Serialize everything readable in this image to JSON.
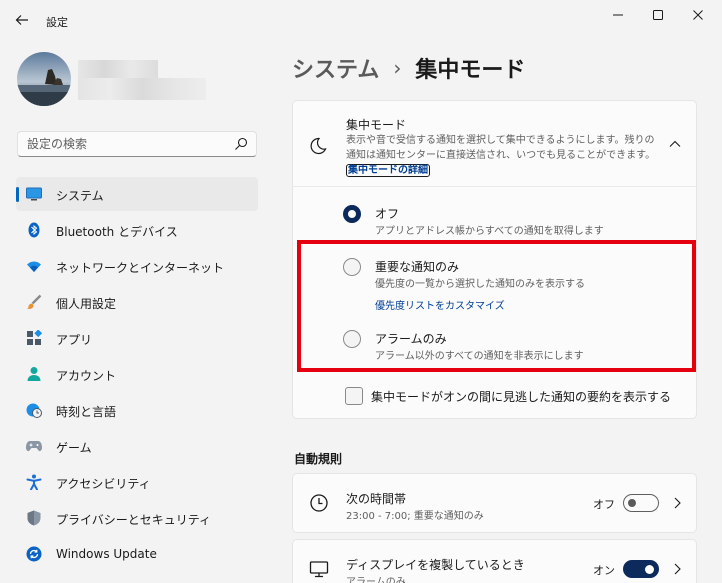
{
  "window": {
    "title": "設定"
  },
  "sidebar": {
    "search_placeholder": "設定の検索",
    "items": [
      {
        "label": "システム",
        "icon": "monitor-icon",
        "selected": true
      },
      {
        "label": "Bluetooth とデバイス",
        "icon": "bluetooth-icon"
      },
      {
        "label": "ネットワークとインターネット",
        "icon": "wifi-icon"
      },
      {
        "label": "個人用設定",
        "icon": "brush-icon"
      },
      {
        "label": "アプリ",
        "icon": "apps-icon"
      },
      {
        "label": "アカウント",
        "icon": "person-icon"
      },
      {
        "label": "時刻と言語",
        "icon": "globe-clock-icon"
      },
      {
        "label": "ゲーム",
        "icon": "gamepad-icon"
      },
      {
        "label": "アクセシビリティ",
        "icon": "accessibility-icon"
      },
      {
        "label": "プライバシーとセキュリティ",
        "icon": "shield-icon"
      },
      {
        "label": "Windows Update",
        "icon": "update-icon"
      }
    ]
  },
  "main": {
    "breadcrumb_parent": "システム",
    "breadcrumb_sep": "›",
    "breadcrumb_current": "集中モード",
    "focus": {
      "title": "集中モード",
      "desc_before_link": "表示や音で受信する通知を選択して集中できるようにします。残りの通知は通知センターに直接送信され、いつでも見ることができます。",
      "link_text": "集中モードの詳細",
      "options": [
        {
          "label": "オフ",
          "desc": "アプリとアドレス帳からすべての通知を取得します",
          "checked": true
        },
        {
          "label": "重要な通知のみ",
          "desc": "優先度の一覧から選択した通知のみを表示する",
          "link": "優先度リストをカスタマイズ",
          "checked": false
        },
        {
          "label": "アラームのみ",
          "desc": "アラーム以外のすべての通知を非表示にします",
          "checked": false
        }
      ],
      "summary_checkbox": "集中モードがオンの間に見逃した通知の要約を表示する"
    },
    "auto_rules": {
      "section_title": "自動規則",
      "rules": [
        {
          "title": "次の時間帯",
          "subtitle": "23:00 - 7:00; 重要な通知のみ",
          "state": "オフ",
          "on": false
        },
        {
          "title": "ディスプレイを複製しているとき",
          "subtitle": "アラームのみ",
          "state": "オン",
          "on": true
        }
      ]
    }
  },
  "colors": {
    "accent": "#0067c0",
    "highlight_box": "#e4000f",
    "radio_checked": "#0d2a5c"
  }
}
